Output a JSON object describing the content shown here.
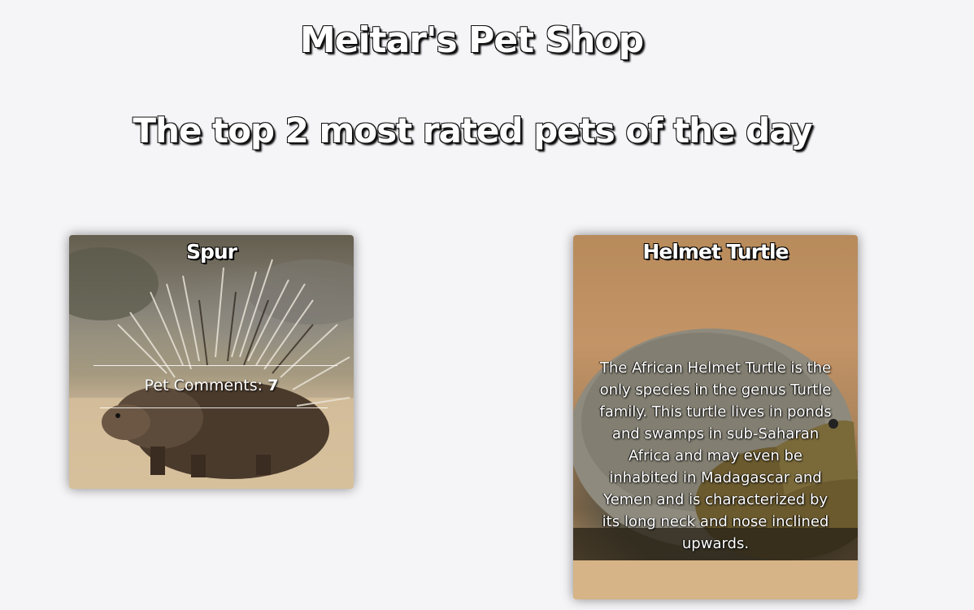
{
  "header": {
    "shop_title": "Meitar's Pet Shop",
    "subtitle": "The top 2 most rated pets of the day"
  },
  "pets": [
    {
      "name": "Spur",
      "comments_label": "Pet Comments:",
      "comments_count": "7"
    },
    {
      "name": "Helmet Turtle",
      "description": "The African Helmet Turtle is the only species in the genus Turtle family. This turtle lives in ponds and swamps in sub-Saharan Africa and may even be inhabited in Madagascar and Yemen and is characterized by its long neck and nose inclined upwards."
    }
  ]
}
